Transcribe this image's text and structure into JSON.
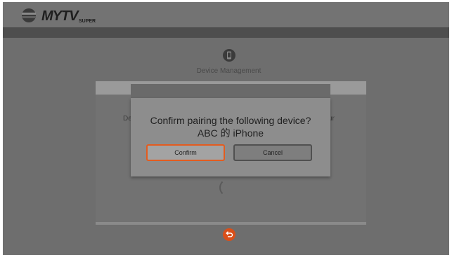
{
  "header": {
    "brand_text": "MyTV SUPER",
    "brand_tag": "SUPER"
  },
  "device_management": {
    "title": "Device Management"
  },
  "background_panel": {
    "left_fragment": "De",
    "right_fragment": "ur"
  },
  "dialog": {
    "message_line1": "Confirm pairing the following device?",
    "message_line2": "ABC 的 iPhone",
    "confirm_label": "Confirm",
    "cancel_label": "Cancel"
  },
  "colors": {
    "accent": "#e35c1f",
    "back_button": "#d94f1a"
  },
  "icons": [
    "tvb-logo-icon",
    "device-icon",
    "back-icon"
  ]
}
